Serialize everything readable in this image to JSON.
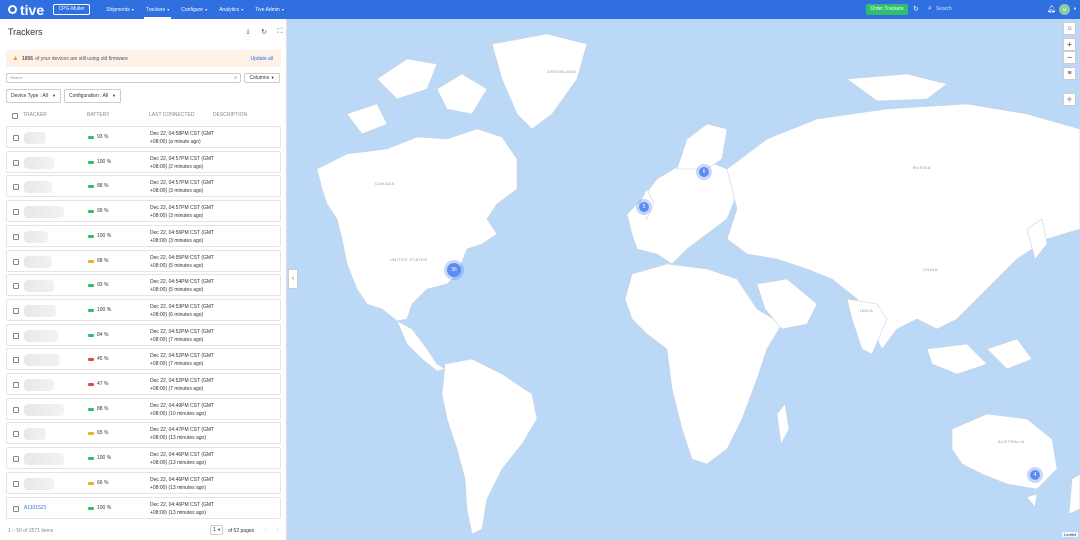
{
  "nav": {
    "logo": "tive",
    "org": "CPG-Muller",
    "items": [
      {
        "label": "Shipments",
        "active": false
      },
      {
        "label": "Trackers",
        "active": true
      },
      {
        "label": "Configure",
        "active": false
      },
      {
        "label": "Analytics",
        "active": false
      },
      {
        "label": "Tive Admin",
        "active": false
      }
    ],
    "order_button": "Order Trackers",
    "search_placeholder": "Search",
    "avatar": "M",
    "colors": {
      "bar": "#2f6fe0",
      "order": "#2ec06a"
    }
  },
  "panel": {
    "title": "Trackers",
    "alert": {
      "count": "1656",
      "text": "of your devices are still using old firmware",
      "action": "Update all"
    },
    "search_placeholder": "Search",
    "columns_button": "Columns",
    "filters": [
      {
        "label": "Device Type :",
        "value": "All"
      },
      {
        "label": "Configuration :",
        "value": "All"
      }
    ],
    "headers": {
      "tracker": "TRACKER",
      "battery": "BATTERY",
      "last_connected": "LAST CONNECTED",
      "description": "DESCRIPTION"
    },
    "rows": [
      {
        "tracker": "",
        "battery": "93 %",
        "level": "high",
        "connected": "Dec 22, 04:58PM CST (GMT +08:00) (a minute ago)"
      },
      {
        "tracker": "",
        "battery": "100 %",
        "level": "high",
        "connected": "Dec 22, 04:57PM CST (GMT +08:00) (2 minutes ago)"
      },
      {
        "tracker": "",
        "battery": "88 %",
        "level": "high",
        "connected": "Dec 22, 04:57PM CST (GMT +08:00) (3 minutes ago)"
      },
      {
        "tracker": "",
        "battery": "99 %",
        "level": "high",
        "connected": "Dec 22, 04:57PM CST (GMT +08:00) (3 minutes ago)"
      },
      {
        "tracker": "",
        "battery": "100 %",
        "level": "high",
        "connected": "Dec 22, 04:56PM CST (GMT +08:00) (3 minutes ago)"
      },
      {
        "tracker": "",
        "battery": "68 %",
        "level": "mid",
        "connected": "Dec 22, 04:55PM CST (GMT +08:00) (5 minutes ago)"
      },
      {
        "tracker": "",
        "battery": "93 %",
        "level": "high",
        "connected": "Dec 22, 04:54PM CST (GMT +08:00) (5 minutes ago)"
      },
      {
        "tracker": "",
        "battery": "100 %",
        "level": "high",
        "connected": "Dec 22, 04:53PM CST (GMT +08:00) (6 minutes ago)"
      },
      {
        "tracker": "",
        "battery": "84 %",
        "level": "high",
        "connected": "Dec 22, 04:52PM CST (GMT +08:00) (7 minutes ago)"
      },
      {
        "tracker": "",
        "battery": "45 %",
        "level": "low",
        "connected": "Dec 22, 04:52PM CST (GMT +08:00) (7 minutes ago)"
      },
      {
        "tracker": "",
        "battery": "47 %",
        "level": "low",
        "connected": "Dec 22, 04:52PM CST (GMT +08:00) (7 minutes ago)"
      },
      {
        "tracker": "",
        "battery": "88 %",
        "level": "high",
        "connected": "Dec 22, 04:49PM CST (GMT +08:00) (10 minutes ago)"
      },
      {
        "tracker": "",
        "battery": "65 %",
        "level": "mid",
        "connected": "Dec 22, 04:47PM CST (GMT +08:00) (13 minutes ago)"
      },
      {
        "tracker": "",
        "battery": "100 %",
        "level": "high",
        "connected": "Dec 22, 04:46PM CST (GMT +08:00) (13 minutes ago)"
      },
      {
        "tracker": "",
        "battery": "66 %",
        "level": "mid",
        "connected": "Dec 22, 04:46PM CST (GMT +08:00) (13 minutes ago)"
      },
      {
        "tracker": "A1101521",
        "battery": "100 %",
        "level": "high",
        "connected": "Dec 22, 04:46PM CST (GMT +08:00) (13 minutes ago)"
      }
    ],
    "battery_colors": {
      "high": "#2ec06a",
      "mid": "#e8b020",
      "low": "#e04848"
    },
    "footer": {
      "count": "1 – 50 of 2571 items",
      "page": "1",
      "of_pages": "of 52 pages"
    }
  },
  "map": {
    "clusters": [
      {
        "label": "6",
        "size": "small"
      },
      {
        "label": "5",
        "size": "small"
      },
      {
        "label": "36",
        "size": "big"
      },
      {
        "label": "4",
        "size": "small"
      }
    ],
    "labels": [
      "GREENLAND",
      "CANADA",
      "UNITED STATES",
      "RUSSIA",
      "CHINA",
      "INDIA",
      "AUSTRALIA"
    ],
    "attribution": "Leaflet",
    "colors": {
      "water": "#bcd8f7",
      "land": "#ffffff"
    }
  }
}
